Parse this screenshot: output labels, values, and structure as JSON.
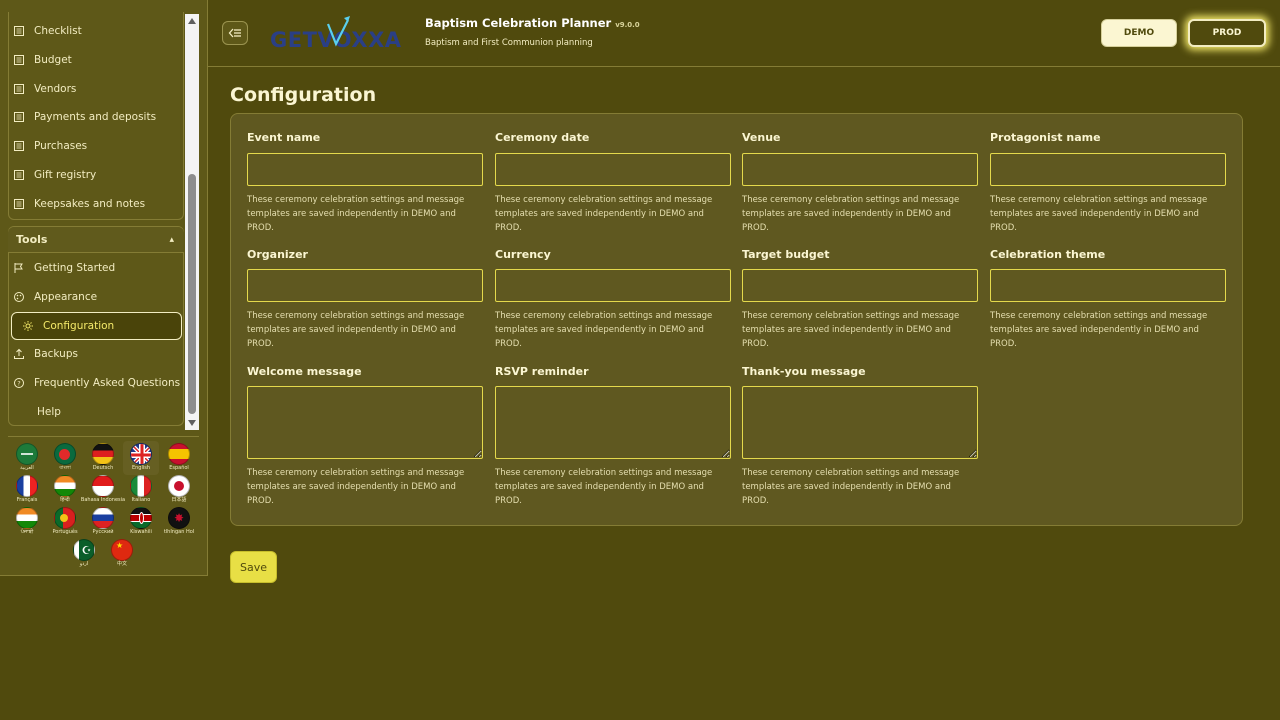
{
  "sidebar": {
    "nav_items": [
      {
        "label": "Checklist",
        "icon": "list-icon"
      },
      {
        "label": "Budget",
        "icon": "list-icon"
      },
      {
        "label": "Vendors",
        "icon": "list-icon"
      },
      {
        "label": "Payments and deposits",
        "icon": "list-icon"
      },
      {
        "label": "Purchases",
        "icon": "list-icon"
      },
      {
        "label": "Gift registry",
        "icon": "list-icon"
      },
      {
        "label": "Keepsakes and notes",
        "icon": "list-icon"
      }
    ],
    "tools": {
      "title": "Tools",
      "items": [
        {
          "label": "Getting Started",
          "icon": "flag-icon"
        },
        {
          "label": "Appearance",
          "icon": "palette-icon"
        },
        {
          "label": "Configuration",
          "icon": "gear-icon",
          "active": true
        },
        {
          "label": "Backups",
          "icon": "upload-icon"
        },
        {
          "label": "Frequently Asked Questions",
          "icon": "question-icon"
        },
        {
          "label": "Help",
          "icon": ""
        }
      ]
    },
    "languages": [
      {
        "name": "العربية"
      },
      {
        "name": "বাংলা"
      },
      {
        "name": "Deutsch"
      },
      {
        "name": "English",
        "current": true
      },
      {
        "name": "Español"
      },
      {
        "name": "Français"
      },
      {
        "name": "हिन्दी"
      },
      {
        "name": "Bahasa Indonesia"
      },
      {
        "name": "Italiano"
      },
      {
        "name": "日本語"
      },
      {
        "name": "ਪੰਜਾਬੀ"
      },
      {
        "name": "Português"
      },
      {
        "name": "Русский"
      },
      {
        "name": "Kiswahili"
      },
      {
        "name": "tlhIngan Hol"
      },
      {
        "name": "اردو"
      },
      {
        "name": "中文"
      }
    ]
  },
  "header": {
    "logo_text": "GETVOXXA",
    "title": "Baptism Celebration Planner",
    "version": "v9.0.0",
    "subtitle": "Baptism and First Communion planning",
    "env_demo": "DEMO",
    "env_prod": "PROD"
  },
  "main": {
    "page_title": "Configuration",
    "help_text": "These ceremony celebration settings and message templates are saved independently in DEMO and PROD.",
    "fields": [
      {
        "label": "Event name",
        "value": ""
      },
      {
        "label": "Ceremony date",
        "value": ""
      },
      {
        "label": "Venue",
        "value": ""
      },
      {
        "label": "Protagonist name",
        "value": ""
      },
      {
        "label": "Organizer",
        "value": ""
      },
      {
        "label": "Currency",
        "value": ""
      },
      {
        "label": "Target budget",
        "value": ""
      },
      {
        "label": "Celebration theme",
        "value": ""
      },
      {
        "label": "Welcome message",
        "value": ""
      },
      {
        "label": "RSVP reminder",
        "value": ""
      },
      {
        "label": "Thank-you message",
        "value": ""
      }
    ],
    "save_label": "Save"
  }
}
